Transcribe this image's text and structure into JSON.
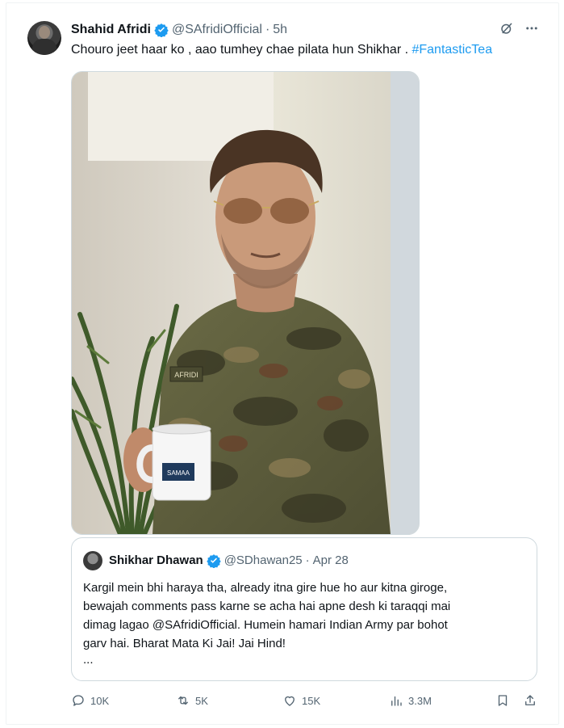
{
  "post": {
    "author_name": "Shahid Afridi",
    "handle": "@SAfridiOfficial",
    "separator": "·",
    "time": "5h",
    "text_before": "Chouro jeet haar ko , aao tumhey chae pilata hun Shikhar . ",
    "hashtag": "#FantasticTea",
    "image_alt": "Man in camouflage shirt and aviator sunglasses holding a white mug"
  },
  "photo": {
    "name_tag": "AFRIDI",
    "mug_logo": "SAMAA"
  },
  "quoted": {
    "author_name": "Shikhar Dhawan",
    "handle": "@SDhawan25",
    "separator": "·",
    "date": "Apr 28",
    "lines": [
      "Kargil mein bhi haraya tha, already itna gire hue ho aur kitna giroge,",
      "bewajah comments pass karne se acha hai apne desh ki taraqqi mai",
      "dimag lagao @SAfridiOfficial. Humein hamari Indian Army par bohot",
      "garv hai. Bharat Mata Ki Jai! Jai Hind!"
    ],
    "ellipsis": "..."
  },
  "actions": {
    "replies": "10K",
    "reposts": "5K",
    "likes": "15K",
    "views": "3.3M"
  },
  "icons": {
    "verified": "verified-badge-icon",
    "grok": "grok-icon",
    "more": "more-icon",
    "reply": "reply-icon",
    "repost": "repost-icon",
    "like": "like-icon",
    "views": "views-icon",
    "bookmark": "bookmark-icon",
    "share": "share-icon"
  },
  "colors": {
    "accent": "#1d9bf0",
    "muted": "#536471",
    "text": "#0f1419",
    "border": "#cfd9de"
  }
}
